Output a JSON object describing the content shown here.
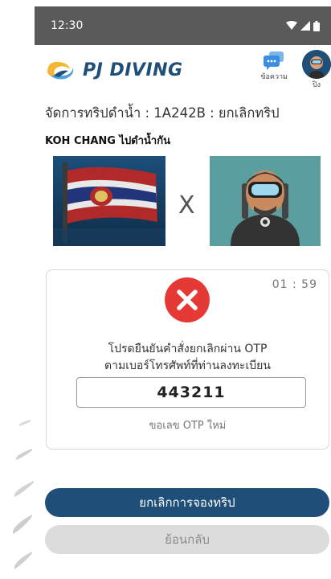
{
  "status_bar": {
    "time": "12:30"
  },
  "header": {
    "brand": "PJ DIVING",
    "messages_label": "ข้อความ",
    "profile_label": "ปิง"
  },
  "breadcrumb": "จัดการทริปดำน้ำ : 1A242B : ยกเลิกทริป",
  "trip_name": "KOH CHANG ไปดำน้ำกัน",
  "compare_mark": "X",
  "otp": {
    "timer": "01 : 59",
    "message_line1": "โปรดยืนยันคำสั่งยกเลิกผ่าน OTP",
    "message_line2": "ตามเบอร์โทรศัพท์ที่ท่านลงทะเบียน",
    "code": "443211",
    "resend_label": "ขอเลข OTP ใหม่"
  },
  "actions": {
    "cancel_booking": "ยกเลิกการจองทริป",
    "back": "ย้อนกลับ"
  },
  "colors": {
    "primary": "#1f4e79",
    "error": "#e53935",
    "status_bar": "#5a5a5a"
  }
}
